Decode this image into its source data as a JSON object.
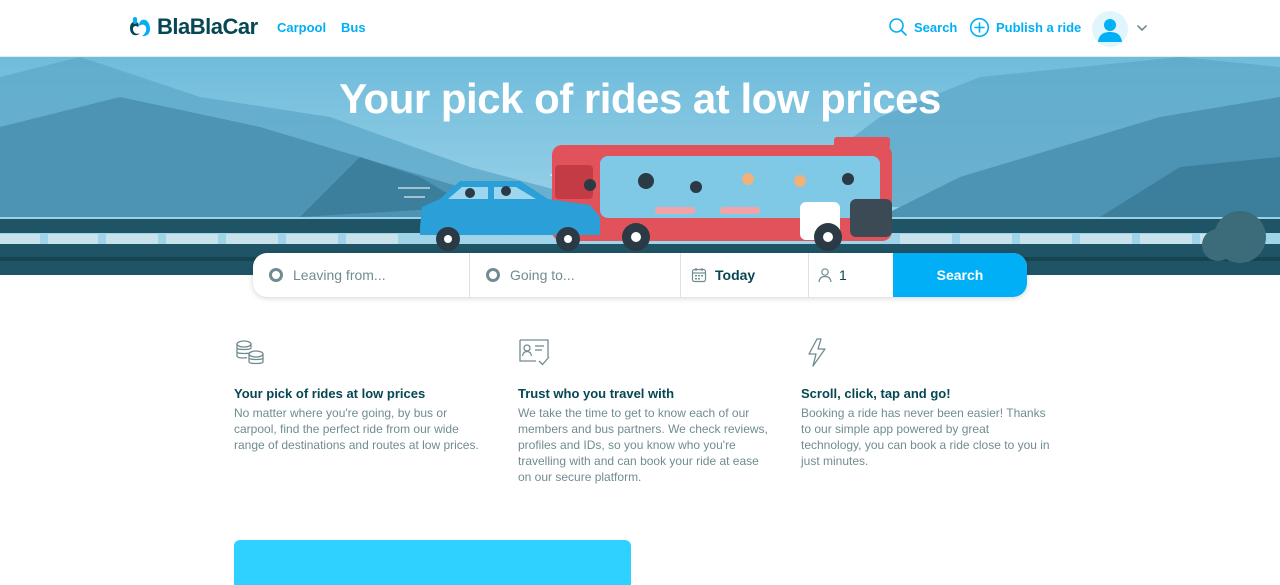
{
  "header": {
    "logo_text": "BlaBlaCar",
    "nav": [
      {
        "label": "Carpool"
      },
      {
        "label": "Bus"
      }
    ],
    "search_label": "Search",
    "publish_label": "Publish a ride"
  },
  "hero": {
    "title": "Your pick of rides at low prices"
  },
  "search": {
    "leaving_placeholder": "Leaving from...",
    "going_placeholder": "Going to...",
    "date_value": "Today",
    "passengers_value": "1",
    "button_label": "Search"
  },
  "features": [
    {
      "icon": "coins-icon",
      "title": "Your pick of rides at low prices",
      "text": "No matter where you're going, by bus or carpool, find the perfect ride from our wide range of destinations and routes at low prices."
    },
    {
      "icon": "id-card-check-icon",
      "title": "Trust who you travel with",
      "text": "We take the time to get to know each of our members and bus partners. We check reviews, profiles and IDs, so you know who you're travelling with and can book your ride at ease on our secure platform."
    },
    {
      "icon": "lightning-icon",
      "title": "Scroll, click, tap and go!",
      "text": "Booking a ride has never been easier! Thanks to our simple app powered by great technology, you can book a ride close to you in just minutes."
    }
  ],
  "colors": {
    "brand": "#00aff5",
    "text_dark": "#054752",
    "text_muted": "#708c91",
    "promo": "#2ed1ff"
  }
}
